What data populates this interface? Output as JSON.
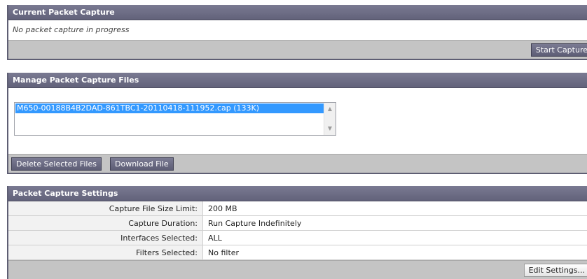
{
  "current_capture": {
    "title": "Current Packet Capture",
    "status": "No packet capture in progress",
    "start_button": "Start Capture"
  },
  "manage_files": {
    "title": "Manage Packet Capture Files",
    "files": [
      "M650-00188B4B2DAD-861TBC1-20110418-111952.cap (133K)"
    ],
    "selected_file": "M650-00188B4B2DAD-861TBC1-20110418-111952.cap (133K)",
    "delete_button": "Delete Selected Files",
    "download_button": "Download File"
  },
  "settings": {
    "title": "Packet Capture Settings",
    "rows": [
      {
        "label": "Capture File Size Limit:",
        "value": "200 MB"
      },
      {
        "label": "Capture Duration:",
        "value": "Run Capture Indefinitely"
      },
      {
        "label": "Interfaces Selected:",
        "value": "ALL"
      },
      {
        "label": "Filters Selected:",
        "value": "No filter"
      }
    ],
    "edit_button": "Edit Settings..."
  },
  "icons": {
    "scroll_up": "scroll-up-arrow-icon",
    "scroll_down": "scroll-down-arrow-icon"
  },
  "colors": {
    "header": "#6b6b84",
    "footer": "#c4c4c4",
    "selection": "#3399ff"
  }
}
